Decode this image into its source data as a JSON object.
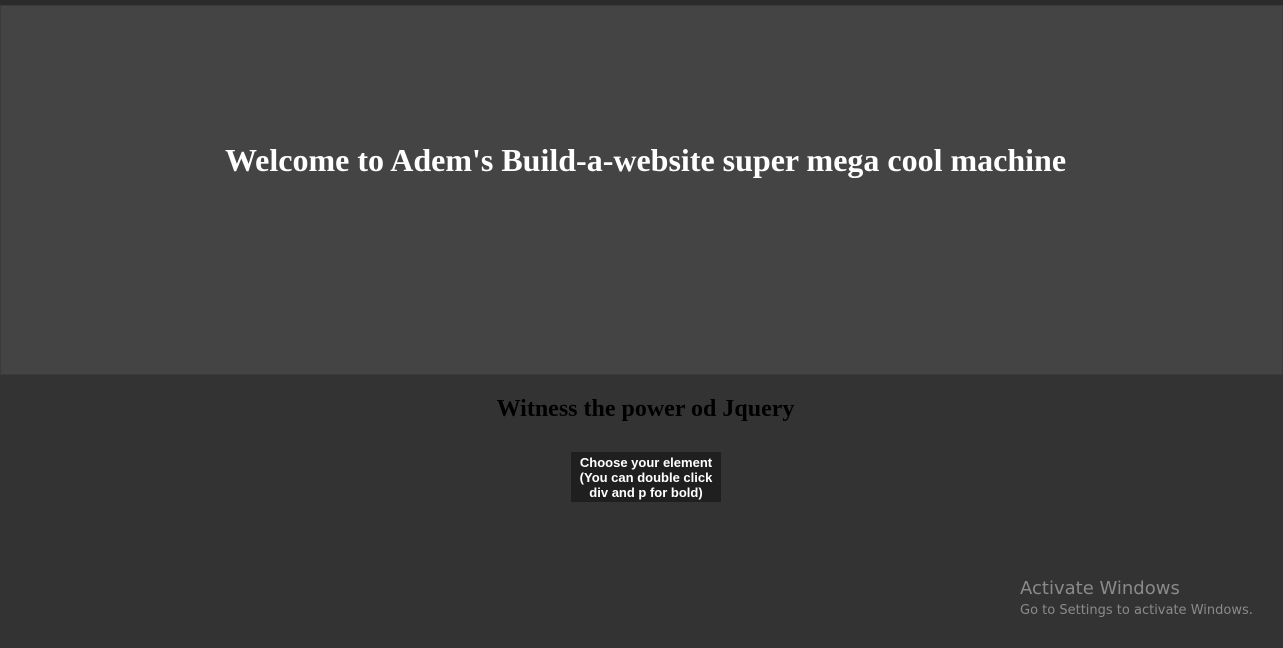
{
  "hero": {
    "title": "Welcome to Adem's Build-a-website super mega cool machine"
  },
  "main": {
    "subtitle": "Witness the power od Jquery",
    "choose_button": {
      "line1": "Choose your element",
      "line2": "(You can double click",
      "line3": "div and p for bold)"
    }
  },
  "os_watermark": {
    "title": "Activate Windows",
    "subtitle": "Go to Settings to activate Windows."
  },
  "colors": {
    "hero_bg": "#444444",
    "page_bg": "#333333",
    "button_bg": "#1f1f1f",
    "heading_text": "#ffffff",
    "subtitle_text": "#000000"
  }
}
